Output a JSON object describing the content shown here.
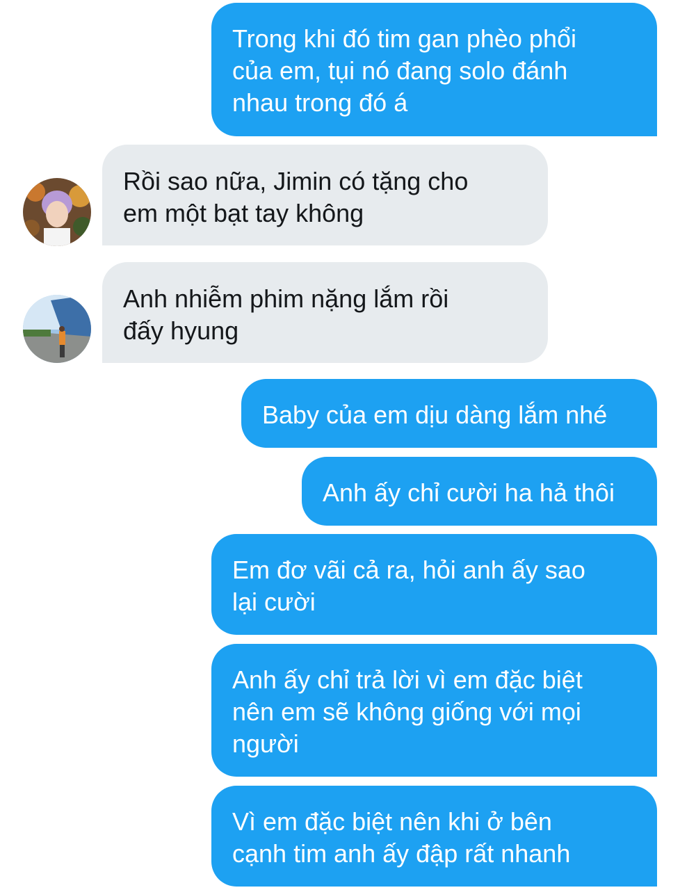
{
  "conversation": {
    "messages": [
      {
        "direction": "outgoing",
        "text": "Trong khi đó tim gan phèo phổi\ncủa em, tụi nó đang solo đánh\nnhau trong đó á"
      },
      {
        "direction": "incoming",
        "avatar": "profile-photo-1",
        "text": "Rồi sao nữa, Jimin có tặng cho\nem một bạt tay không"
      },
      {
        "direction": "incoming",
        "avatar": "profile-photo-2",
        "text": "Anh nhiễm phim nặng lắm rồi\nđấy hyung"
      },
      {
        "direction": "outgoing",
        "text": "Baby của em dịu dàng lắm nhé"
      },
      {
        "direction": "outgoing",
        "text": "Anh ấy chỉ cười ha hả thôi"
      },
      {
        "direction": "outgoing",
        "text": "Em đơ vãi cả ra, hỏi anh ấy sao\nlại cười"
      },
      {
        "direction": "outgoing",
        "text": "Anh ấy chỉ trả lời vì em đặc biệt\nnên em sẽ không giống với mọi\nngười"
      },
      {
        "direction": "outgoing",
        "text": "Vì em đặc biệt nên khi ở bên\ncạnh tim anh ấy đập rất nhanh"
      }
    ]
  },
  "colors": {
    "outgoing_bubble": "#1da1f2",
    "incoming_bubble": "#e7ebee",
    "outgoing_text": "#ffffff",
    "incoming_text": "#14171a"
  }
}
